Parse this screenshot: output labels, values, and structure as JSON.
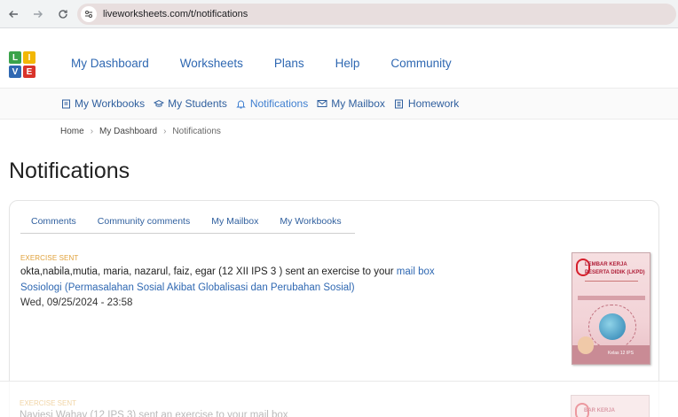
{
  "browser": {
    "url": "liveworksheets.com/t/notifications",
    "back_icon": "arrow-left-icon",
    "forward_icon": "arrow-right-icon",
    "reload_icon": "reload-icon"
  },
  "logo": {
    "letters": [
      "L",
      "I",
      "V",
      "E"
    ],
    "colors": [
      "#3aa34a",
      "#f2b705",
      "#2f68b2",
      "#d9342b"
    ]
  },
  "main_nav": [
    "My Dashboard",
    "Worksheets",
    "Plans",
    "Help",
    "Community"
  ],
  "sub_nav": [
    {
      "label": "My Workbooks",
      "icon": "workbook-icon"
    },
    {
      "label": "My Students",
      "icon": "graduation-cap-icon"
    },
    {
      "label": "Notifications",
      "icon": "bell-icon"
    },
    {
      "label": "My Mailbox",
      "icon": "envelope-icon"
    },
    {
      "label": "Homework",
      "icon": "homework-icon"
    }
  ],
  "breadcrumb": [
    "Home",
    "My Dashboard",
    "Notifications"
  ],
  "page_title": "Notifications",
  "tabs": [
    "Comments",
    "Community comments",
    "My Mailbox",
    "My Workbooks"
  ],
  "notification": {
    "type": "EXERCISE SENT",
    "text_before_link": "okta,nabila,mutia, maria, nazarul, faiz, egar (12 XII IPS 3 ) sent an exercise to your ",
    "link_mailbox": "mail box",
    "worksheet_title": "Sosiologi (Permasalahan Sosial Akibat Globalisasi dan Perubahan Sosial)",
    "date": "Wed, 09/25/2024 - 23:58",
    "thumbnail": {
      "line1": "LEMBAR KERJA",
      "line2": "PESERTA DIDIK (LKPD)",
      "caption": "Kelas 12 IPS"
    }
  },
  "notification2": {
    "type": "EXERCISE SENT",
    "text": "Naviesi Wahay (12 IPS 3) sent an exercise to your mail box",
    "thumb_text": "BAR KERJA"
  },
  "colors": {
    "link": "#2f68b2",
    "exercise_sent": "#e0a13a"
  }
}
